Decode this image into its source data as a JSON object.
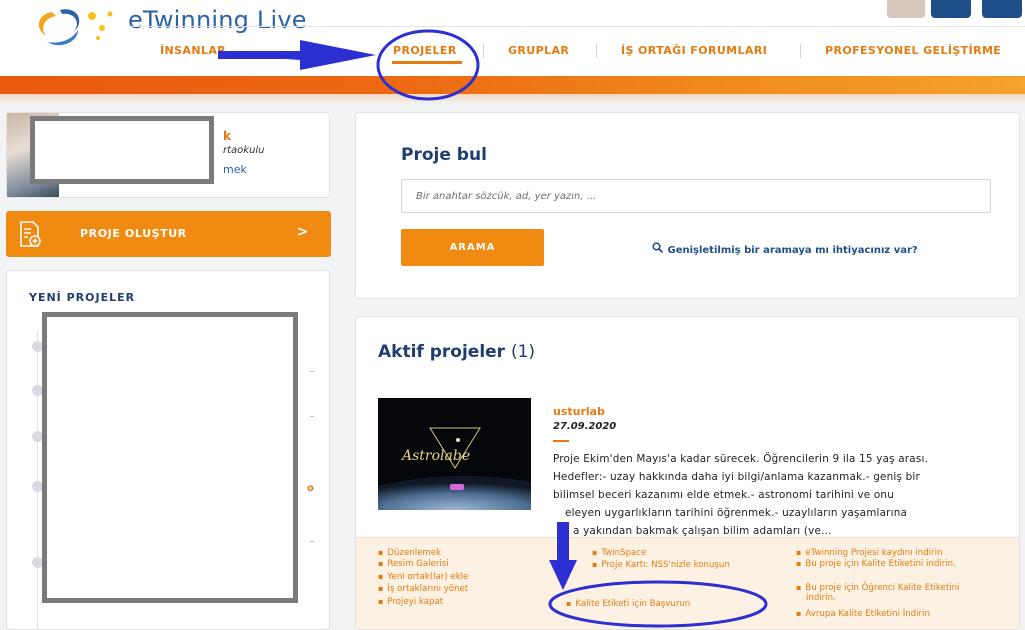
{
  "brand": {
    "name": "eTwinning Live"
  },
  "nav": {
    "items": [
      {
        "label": "İNSANLAR"
      },
      {
        "label": "PROJELER"
      },
      {
        "label": "GRUPLAR"
      },
      {
        "label": "İŞ ORTAĞI FORUMLARI"
      },
      {
        "label": "PROFESYONEL GELİŞTİRME"
      }
    ],
    "active": "PROJELER"
  },
  "profile": {
    "name_fragment": "k",
    "school_fragment": "rtaokulu",
    "link_fragment": "mek"
  },
  "sidebar": {
    "create_label": "PROJE OLUŞTUR",
    "create_chevron": ">",
    "new_projects_title": "YENİ PROJELER",
    "accent_fragment": "o"
  },
  "search": {
    "title": "Proje bul",
    "placeholder": "Bir anahtar sözcük, ad, yer yazın, ...",
    "button_label": "ARAMA",
    "advanced_label": "Genişletilmiş bir aramaya mı ihtiyacınız var?"
  },
  "active_projects": {
    "title": "Aktif projeler",
    "count": "(1)",
    "project": {
      "name": "usturlab",
      "date": "27.09.2020",
      "thumbnail_text": "Astrolabe",
      "description_lines": [
        "Proje Ekim'den Mayıs'a kadar sürecek. Öğrencilerin 9 ila 15 yaş arası.",
        "Hedefler:- uzay hakkında daha iyi bilgi/anlama kazanmak.- geniş bir",
        "bilimsel beceri kazanımı elde etmek.- astronomi tarihini ve onu",
        "eleyen uygarlıkların tarihini öğrenmek.- uzaylıların yaşamlarına",
        "a yakından bakmak çalışan bilim adamları (ve..."
      ]
    },
    "actions": {
      "col1": [
        "Düzenlemek",
        "Resim Galerisi",
        "Yeni ortak(lar) ekle",
        "İş ortaklarını yönet",
        "Projeyi kapat"
      ],
      "col2": [
        "TwinSpace",
        "Proje Kartı: NSS'nizle konuşun",
        "Kalite Etiketi için Başvurun"
      ],
      "col3": [
        "eTwinning Projesi kaydını indirin",
        "Bu proje için Kalite Etiketini indirin.",
        "Bu proje için Öğrenci Kalite Etiketini indirin.",
        "Avrupa Kalite Etiketini İndirin"
      ]
    }
  },
  "colors": {
    "accent": "#e57b10",
    "button": "#f08a10",
    "navy": "#1e3e6e",
    "annotation_blue": "#2c2fd1"
  }
}
